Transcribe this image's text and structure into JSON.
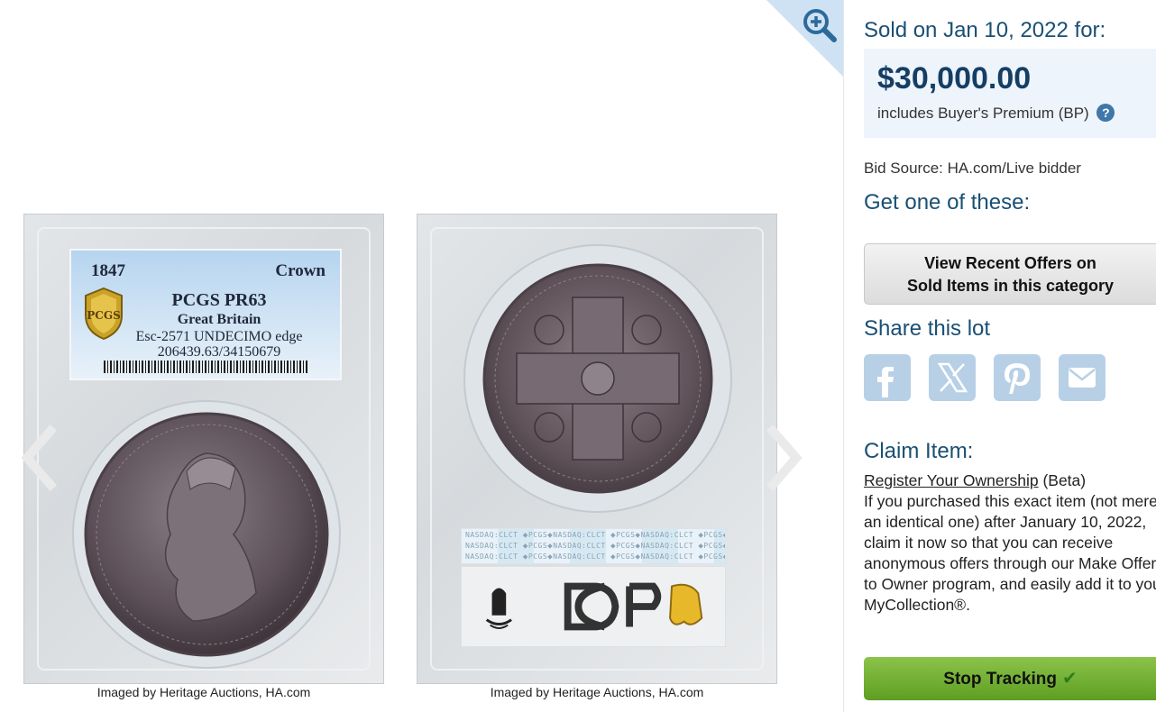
{
  "gallery": {
    "front": {
      "label": {
        "year": "1847",
        "denomination": "Crown",
        "grade": "PCGS PR63",
        "country": "Great Britain",
        "variety": "Esc-2571 UNDECIMO edge",
        "cert": "206439.63/34150679"
      },
      "caption": "Imaged by Heritage Auctions, HA.com"
    },
    "back": {
      "hologram_text": "NASDAQ:CLCT ⬥PCGS⬥NASDAQ:CLCT ⬥PCGS⬥NASDAQ:CLCT ⬥PCGS⬥NASDAQ:CLCT",
      "caption": "Imaged by Heritage Auctions, HA.com"
    },
    "icons": [
      "zoom-in-icon",
      "chevron-left-icon",
      "chevron-right-icon"
    ]
  },
  "sidebar": {
    "sold_heading": "Sold on Jan 10, 2022 for:",
    "price": "$30,000.00",
    "premium_note": "includes Buyer's Premium (BP)",
    "help_symbol": "?",
    "bid_source": "Bid Source: HA.com/Live bidder",
    "get_heading": "Get one of these:",
    "offers_button": {
      "line1": "View Recent Offers on",
      "line2": "Sold Items in this category"
    },
    "share_heading": "Share this lot",
    "share_icons": [
      "facebook-icon",
      "x-icon",
      "pinterest-icon",
      "email-icon"
    ],
    "claim_heading": "Claim Item:",
    "claim_link": "Register Your Ownership",
    "claim_beta": " (Beta)",
    "claim_body": "If you purchased this exact item (not merely an identical one) after January 10, 2022, claim it now so that you can receive anonymous offers through our Make Offer to Owner program, and easily add it to your MyCollection®.",
    "stop_tracking": "Stop Tracking",
    "check_symbol": "✔"
  },
  "colors": {
    "heading_blue": "#1a4f73",
    "price_box": "#eef4fb",
    "share_button": "#b8d0e6",
    "stop_button": "#6aa82c"
  }
}
